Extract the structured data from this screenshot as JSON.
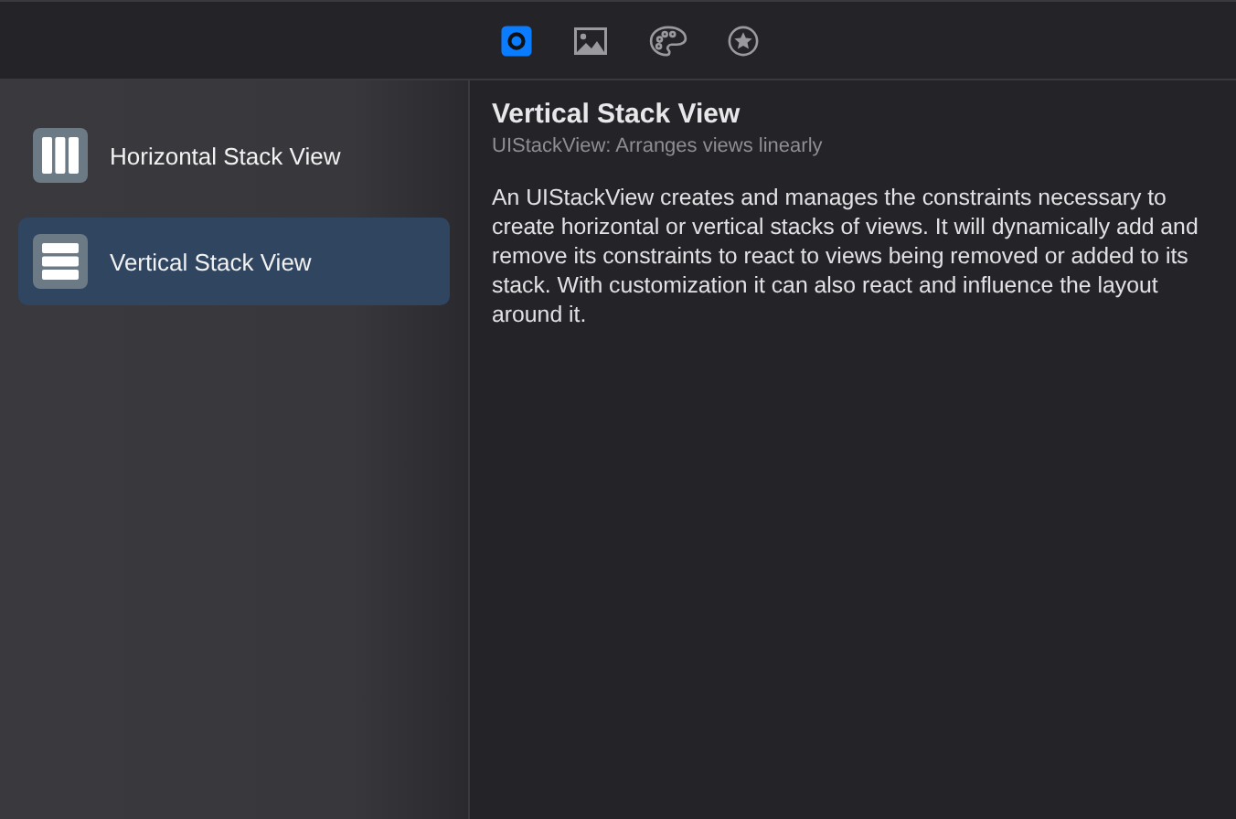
{
  "toolbar": {
    "tabs": [
      {
        "kind": "object",
        "selected": true
      },
      {
        "kind": "media",
        "selected": false
      },
      {
        "kind": "color",
        "selected": false
      },
      {
        "kind": "symbol",
        "selected": false
      }
    ]
  },
  "sidebar": {
    "items": [
      {
        "kind": "horizontal",
        "label": "Horizontal Stack View",
        "selected": false
      },
      {
        "kind": "vertical",
        "label": "Vertical Stack View",
        "selected": true
      }
    ]
  },
  "detail": {
    "title": "Vertical Stack View",
    "subtitle": "UIStackView: Arranges views linearly",
    "description": "An UIStackView creates and manages the constraints necessary to create horizontal or vertical stacks of views. It will dynamically add and remove its constraints to react to views being removed or added to its stack. With customization it can also react and influence the layout around it."
  }
}
